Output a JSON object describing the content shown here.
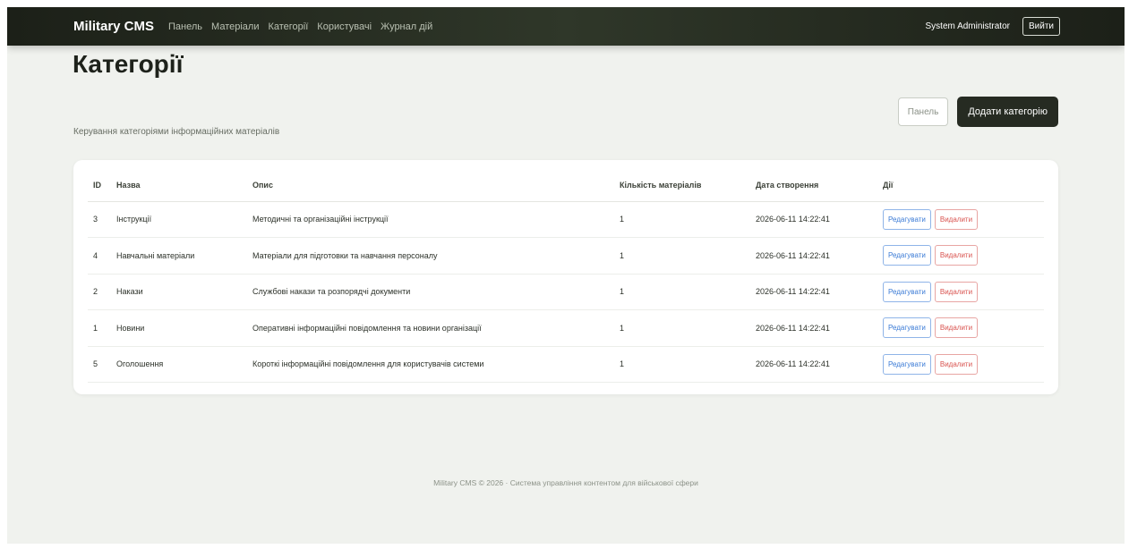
{
  "nav": {
    "brand": "Military CMS",
    "links": [
      "Панель",
      "Матеріали",
      "Категорії",
      "Користувачі",
      "Журнал дій"
    ],
    "user": "System Administrator",
    "logout": "Вийти"
  },
  "header": {
    "title": "Категорії",
    "subtitle": "Керування категоріями інформаційних матеріалів",
    "panel_button": "Панель",
    "add_button": "Додати категорію"
  },
  "table": {
    "columns": [
      "ID",
      "Назва",
      "Опис",
      "Кількість матеріалів",
      "Дата створення",
      "Дії"
    ],
    "rows": [
      {
        "id": "3",
        "name": "Інструкції",
        "desc": "Методичні та організаційні інструкції",
        "count": "1",
        "date": "2026-06-11 14:22:41"
      },
      {
        "id": "4",
        "name": "Навчальні матеріали",
        "desc": "Матеріали для підготовки та навчання персоналу",
        "count": "1",
        "date": "2026-06-11 14:22:41"
      },
      {
        "id": "2",
        "name": "Накази",
        "desc": "Службові накази та розпорядчі документи",
        "count": "1",
        "date": "2026-06-11 14:22:41"
      },
      {
        "id": "1",
        "name": "Новини",
        "desc": "Оперативні інформаційні повідомлення та новини організації",
        "count": "1",
        "date": "2026-06-11 14:22:41"
      },
      {
        "id": "5",
        "name": "Оголошення",
        "desc": "Короткі інформаційні повідомлення для користувачів системи",
        "count": "1",
        "date": "2026-06-11 14:22:41"
      }
    ],
    "edit_label": "Редагувати",
    "delete_label": "Видалити"
  },
  "footer": {
    "text": "Military CMS © 2026 · Система управління контентом для військової сфери"
  },
  "colors": {
    "navbar": "#262b22",
    "background": "#f0f2ee",
    "edit": "#3b7bd6",
    "delete": "#d9534f"
  }
}
